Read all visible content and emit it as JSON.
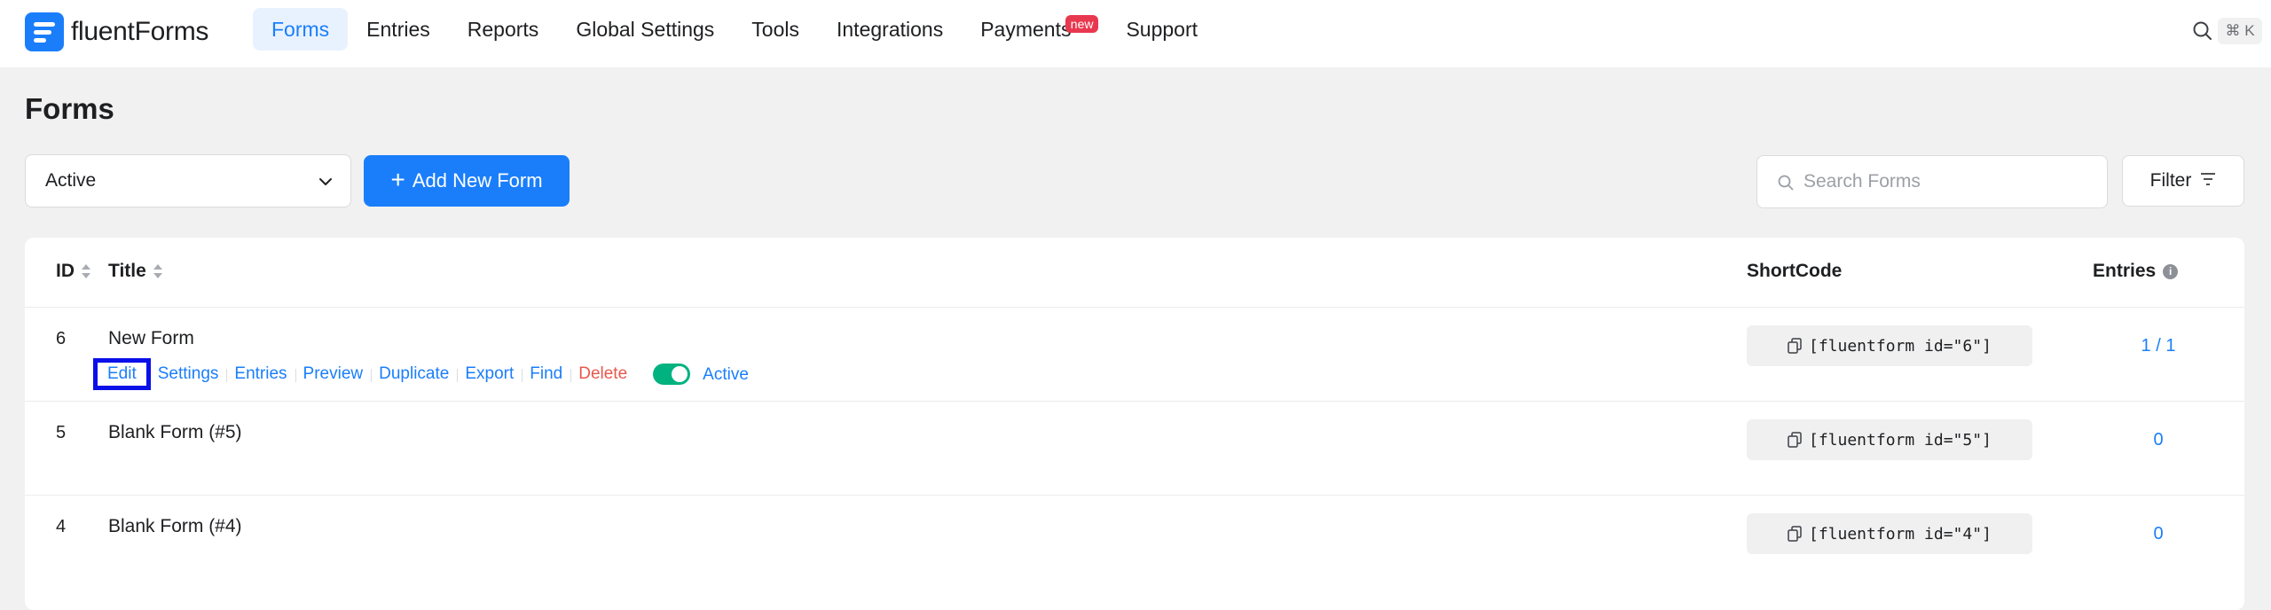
{
  "brand": {
    "name_light": "fluent",
    "name_bold": "Forms"
  },
  "nav": {
    "items": [
      {
        "label": "Forms"
      },
      {
        "label": "Entries"
      },
      {
        "label": "Reports"
      },
      {
        "label": "Global Settings"
      },
      {
        "label": "Tools"
      },
      {
        "label": "Integrations"
      },
      {
        "label": "Payments",
        "badge": "new"
      },
      {
        "label": "Support"
      }
    ],
    "shortcut": "⌘ K"
  },
  "page": {
    "title": "Forms"
  },
  "controls": {
    "status_value": "Active",
    "add_label": "Add New Form",
    "search_placeholder": "Search Forms",
    "filter_label": "Filter"
  },
  "table": {
    "headers": {
      "id": "ID",
      "title": "Title",
      "shortcode": "ShortCode",
      "entries": "Entries"
    },
    "actions": [
      "Edit",
      "Settings",
      "Entries",
      "Preview",
      "Duplicate",
      "Export",
      "Find",
      "Delete"
    ],
    "status_label": "Active",
    "rows": [
      {
        "id": "6",
        "title": "New Form",
        "shortcode": "[fluentform id=\"6\"]",
        "entries": "1 / 1"
      },
      {
        "id": "5",
        "title": "Blank Form (#5)",
        "shortcode": "[fluentform id=\"5\"]",
        "entries": "0"
      },
      {
        "id": "4",
        "title": "Blank Form (#4)",
        "shortcode": "[fluentform id=\"4\"]",
        "entries": "0"
      }
    ]
  },
  "colors": {
    "accent": "#1a7efb",
    "delete": "#e8584c",
    "toggle_on": "#00b27f",
    "highlight": "#0a10e8"
  }
}
